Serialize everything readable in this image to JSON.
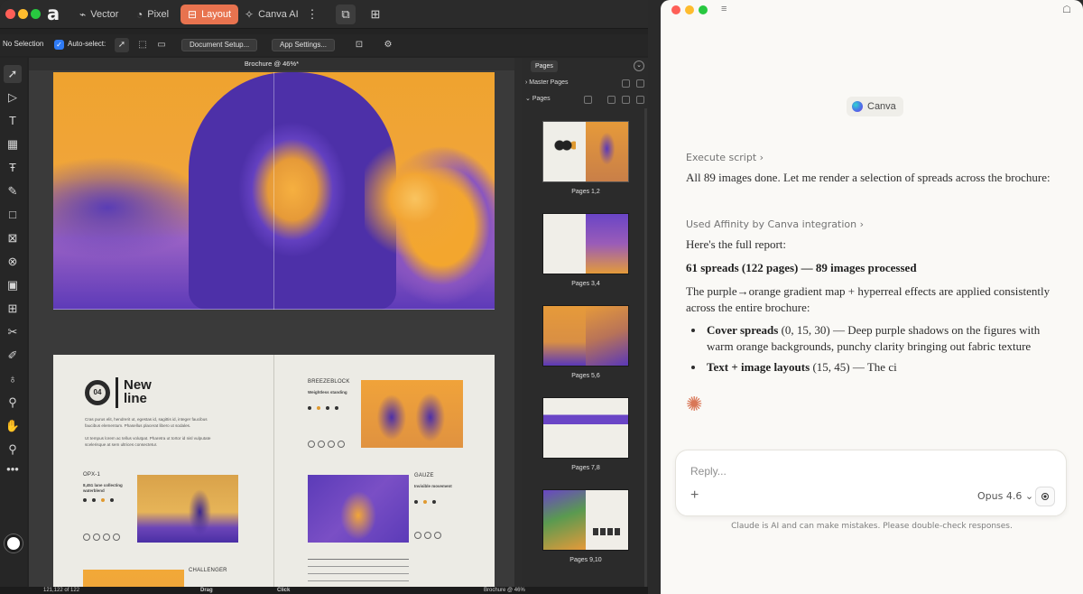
{
  "affinity": {
    "personas": [
      {
        "icon": "vector-persona-icon",
        "label": "Vector"
      },
      {
        "icon": "pixel-persona-icon",
        "label": "Pixel"
      },
      {
        "icon": "layout-persona-icon",
        "label": "Layout",
        "active": true
      },
      {
        "icon": "canva-ai-persona-icon",
        "label": "Canva AI"
      }
    ],
    "context": {
      "selection": "No Selection",
      "auto_select": "Auto-select:",
      "document_setup": "Document Setup...",
      "app_settings": "App Settings..."
    },
    "document_tab": "Brochure @ 46%*",
    "spread2": {
      "number": "04",
      "title": "New\nline",
      "intro": "Cras purus elit, hendrerit ut, egestas id, sagittis id, integer faucibus\nfaucibus elementum. Phasellus placerat libero ut sodales.\n\nUt tempus lorem ac tellus volutpat. Pharetra ut tortor id nisl vulputate\nscelerisque at sem ultrices consectetur.",
      "breezeblock": "BREEZEBLOCK",
      "breezeblock_sub": "Weightless standing",
      "opx": "OPX-1",
      "opx_sub": "8,451 lane collecting\nwaterblend",
      "gauze": "GAUZE",
      "gauze_sub": "Invisible movement",
      "challenger": "CHALLENGER"
    },
    "panel": {
      "tab": "Pages",
      "master_pages": "Master Pages",
      "pages": "Pages",
      "thumbs": [
        "Pages 1,2",
        "Pages 3,4",
        "Pages 5,6",
        "Pages 7,8",
        "Pages 9,10"
      ]
    },
    "status": {
      "page_counter": "121,122 of 122",
      "drag_hint": "Drag",
      "click_hint": "Click",
      "zoom_hint": "Brochure @ 46%"
    }
  },
  "claude": {
    "integration_chip": "Canva",
    "execute_script": "Execute script",
    "msg1": "All 89 images done. Let me render a selection of spreads across the brochure:",
    "used_integration": "Used Affinity by Canva integration",
    "report_intro": "Here's the full report:",
    "summary_bold": "61 spreads (122 pages) — 89 images processed",
    "gradient_para": "The purple→orange gradient map + hyperreal effects are applied consistently across the entire brochure:",
    "bullet1_bold": "Cover spreads",
    "bullet1_rest": " (0, 15, 30) — Deep purple shadows on the figures with warm orange backgrounds, punchy clarity bringing out fabric texture",
    "bullet2_bold": "Text + image layouts",
    "bullet2_rest": " (15, 45) — The ci",
    "reply_placeholder": "Reply...",
    "model": "Opus 4.6",
    "disclaimer": "Claude is AI and can make mistakes. Please double-check responses."
  },
  "colors": {
    "layout_accent": "#e8734f",
    "gradient_purple": "#5a38b8",
    "gradient_orange": "#f2a432",
    "claude_spark": "#d97757"
  }
}
